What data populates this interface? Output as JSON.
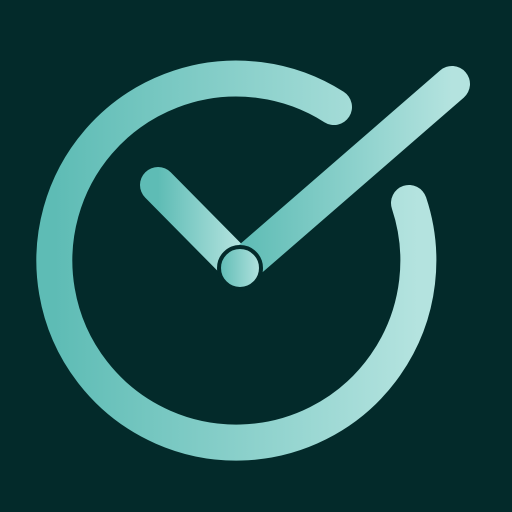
{
  "icon": {
    "name": "clock-check-icon",
    "colors": {
      "background": "#032a2a",
      "gradient_start": "#5ebcb5",
      "gradient_end": "#b4e3df",
      "dial_center_ring": "#032a2a"
    }
  }
}
